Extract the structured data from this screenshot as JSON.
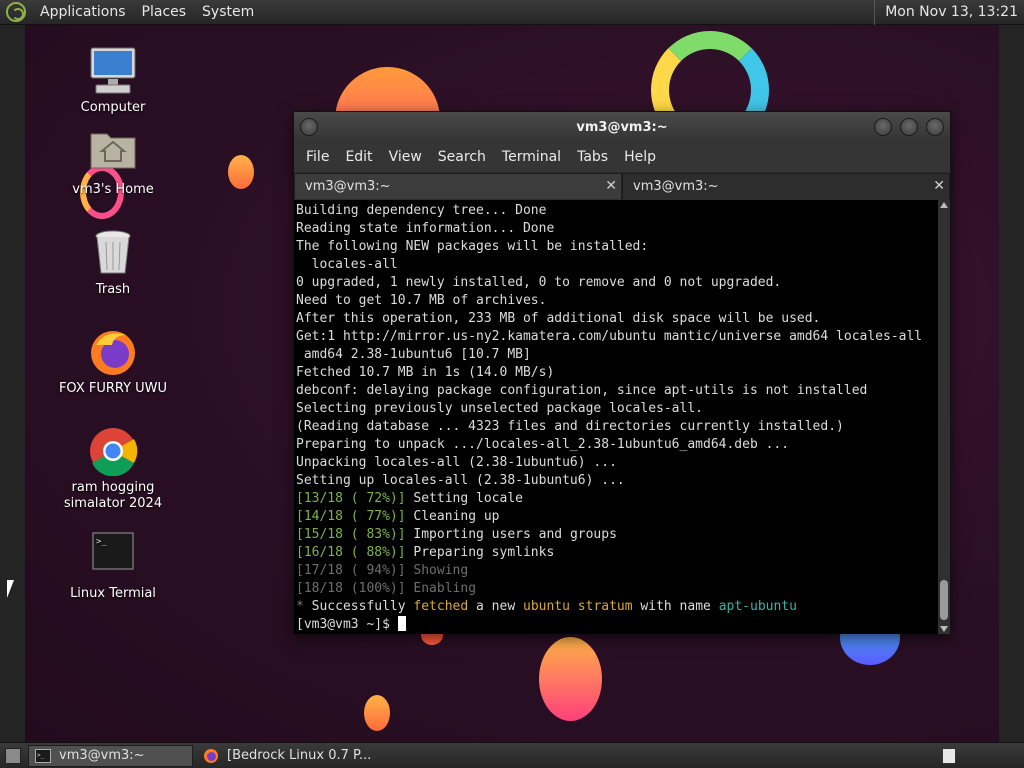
{
  "top_panel": {
    "menus": [
      "Applications",
      "Places",
      "System"
    ],
    "clock": "Mon Nov 13, 13:21"
  },
  "desktop_icons": [
    {
      "label": "Computer",
      "icon": "computer-icon"
    },
    {
      "label": "vm3's Home",
      "icon": "home-folder-icon"
    },
    {
      "label": "Trash",
      "icon": "trash-icon"
    },
    {
      "label": "FOX FURRY UWU",
      "icon": "firefox-icon"
    },
    {
      "label": "ram hogging simalator 2024",
      "icon": "chrome-icon"
    },
    {
      "label": "Linux Termial",
      "icon": "terminal-icon"
    }
  ],
  "terminal": {
    "title": "vm3@vm3:~",
    "menu": [
      "File",
      "Edit",
      "View",
      "Search",
      "Terminal",
      "Tabs",
      "Help"
    ],
    "tabs": [
      {
        "label": "vm3@vm3:~",
        "active": false
      },
      {
        "label": "vm3@vm3:~",
        "active": true
      }
    ],
    "lines": [
      {
        "parts": [
          {
            "t": "Building dependency tree... Done",
            "c": ""
          }
        ]
      },
      {
        "parts": [
          {
            "t": "Reading state information... Done",
            "c": ""
          }
        ]
      },
      {
        "parts": [
          {
            "t": "The following NEW packages will be installed:",
            "c": ""
          }
        ]
      },
      {
        "parts": [
          {
            "t": "  locales-all",
            "c": ""
          }
        ]
      },
      {
        "parts": [
          {
            "t": "0 upgraded, 1 newly installed, 0 to remove and 0 not upgraded.",
            "c": ""
          }
        ]
      },
      {
        "parts": [
          {
            "t": "Need to get 10.7 MB of archives.",
            "c": ""
          }
        ]
      },
      {
        "parts": [
          {
            "t": "After this operation, 233 MB of additional disk space will be used.",
            "c": ""
          }
        ]
      },
      {
        "parts": [
          {
            "t": "Get:1 http://mirror.us-ny2.kamatera.com/ubuntu mantic/universe amd64 locales-all",
            "c": ""
          }
        ]
      },
      {
        "parts": [
          {
            "t": " amd64 2.38-1ubuntu6 [10.7 MB]",
            "c": ""
          }
        ]
      },
      {
        "parts": [
          {
            "t": "Fetched 10.7 MB in 1s (14.0 MB/s)",
            "c": ""
          }
        ]
      },
      {
        "parts": [
          {
            "t": "debconf: delaying package configuration, since apt-utils is not installed",
            "c": ""
          }
        ]
      },
      {
        "parts": [
          {
            "t": "Selecting previously unselected package locales-all.",
            "c": ""
          }
        ]
      },
      {
        "parts": [
          {
            "t": "(Reading database ... 4323 files and directories currently installed.)",
            "c": ""
          }
        ]
      },
      {
        "parts": [
          {
            "t": "Preparing to unpack .../locales-all_2.38-1ubuntu6_amd64.deb ...",
            "c": ""
          }
        ]
      },
      {
        "parts": [
          {
            "t": "Unpacking locales-all (2.38-1ubuntu6) ...",
            "c": ""
          }
        ]
      },
      {
        "parts": [
          {
            "t": "Setting up locales-all (2.38-1ubuntu6) ...",
            "c": ""
          }
        ]
      },
      {
        "parts": [
          {
            "t": "[13/18 ( 72%)]",
            "c": "c-green"
          },
          {
            "t": " Setting locale",
            "c": ""
          }
        ]
      },
      {
        "parts": [
          {
            "t": "[14/18 ( 77%)]",
            "c": "c-green"
          },
          {
            "t": " Cleaning up",
            "c": ""
          }
        ]
      },
      {
        "parts": [
          {
            "t": "[15/18 ( 83%)]",
            "c": "c-green"
          },
          {
            "t": " Importing users and groups",
            "c": ""
          }
        ]
      },
      {
        "parts": [
          {
            "t": "[16/18 ( 88%)]",
            "c": "c-green"
          },
          {
            "t": " Preparing symlinks",
            "c": ""
          }
        ]
      },
      {
        "parts": [
          {
            "t": "[17/18 ( 94%)]",
            "c": "c-gray"
          },
          {
            "t": " Showing",
            "c": "c-gray"
          }
        ]
      },
      {
        "parts": [
          {
            "t": "[18/18 (100%)]",
            "c": "c-gray"
          },
          {
            "t": " Enabling",
            "c": "c-gray"
          }
        ]
      },
      {
        "parts": [
          {
            "t": "* ",
            "c": "c-mid"
          },
          {
            "t": "Successfully ",
            "c": ""
          },
          {
            "t": "fetched",
            "c": "c-yellow"
          },
          {
            "t": " a new ",
            "c": ""
          },
          {
            "t": "ubuntu",
            "c": "c-yellow"
          },
          {
            "t": " ",
            "c": ""
          },
          {
            "t": "stratum",
            "c": "c-yellow"
          },
          {
            "t": " with name ",
            "c": ""
          },
          {
            "t": "apt-ubuntu",
            "c": "c-teal"
          }
        ]
      }
    ],
    "prompt": "[vm3@vm3 ~]$ "
  },
  "taskbar": {
    "tasks": [
      {
        "label": "vm3@vm3:~",
        "icon": "terminal-icon",
        "active": true
      },
      {
        "label": "[Bedrock Linux 0.7 P...",
        "icon": "firefox-icon",
        "active": false
      }
    ]
  },
  "colors": {
    "wallpaper": "#2a0f24",
    "panel": "#2f2f2f",
    "terminal_bg": "#000000",
    "progress_green": "#7fb34a",
    "highlight_yellow": "#d6a83a",
    "highlight_teal": "#3fb2a2"
  }
}
